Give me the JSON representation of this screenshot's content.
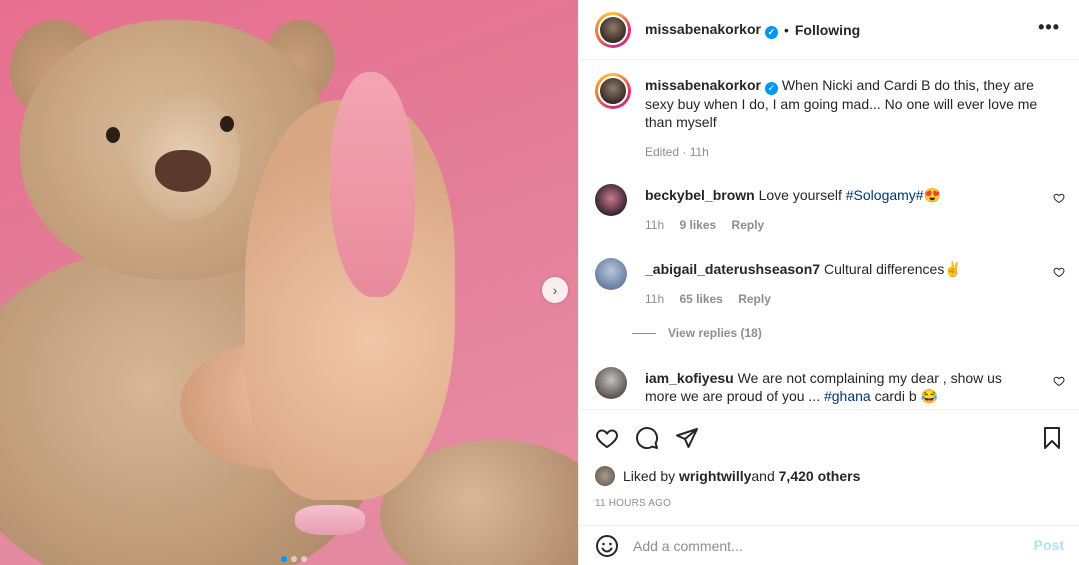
{
  "header": {
    "username": "missabenakorkor",
    "separator": "•",
    "follow_state": "Following",
    "more_label": "•••"
  },
  "caption": {
    "username": "missabenakorkor",
    "text": "When Nicki and Cardi B do this, they are sexy buy when I do, I am going mad... No one will ever love me than myself",
    "meta": "Edited · 11h"
  },
  "comments": [
    {
      "username": "beckybel_brown",
      "text_before": "Love yourself ",
      "hashtag": "#Sologamy#",
      "text_after": "😍",
      "time": "11h",
      "likes": "9 likes",
      "reply": "Reply"
    },
    {
      "username": "_abigail_daterushseason7",
      "text_before": "Cultural differences✌",
      "hashtag": "",
      "text_after": "",
      "time": "11h",
      "likes": "65 likes",
      "reply": "Reply",
      "view_replies": "View replies (18)"
    },
    {
      "username": "iam_kofiyesu",
      "text_before": "We are not complaining my dear , show us more we are proud of you ... ",
      "hashtag": "#ghana",
      "text_after": " cardi b 😂"
    }
  ],
  "likes": {
    "prefix": "Liked by ",
    "user": "wrightwilly",
    "middle": " and ",
    "others": "7,420 others"
  },
  "time_ago": "11 HOURS AGO",
  "add_comment": {
    "placeholder": "Add a comment...",
    "post_label": "Post"
  },
  "carousel": {
    "next_glyph": "›",
    "dot_count": 3,
    "active_index": 0
  },
  "colors": {
    "accent": "#0095f6",
    "post_disabled": "#b2dffc",
    "hashtag": "#00376b",
    "muted": "#8e8e8e"
  },
  "icons": [
    "heart-icon",
    "comment-icon",
    "share-icon",
    "bookmark-icon",
    "emoji-icon",
    "verified-icon",
    "more-icon",
    "chevron-right-icon"
  ]
}
